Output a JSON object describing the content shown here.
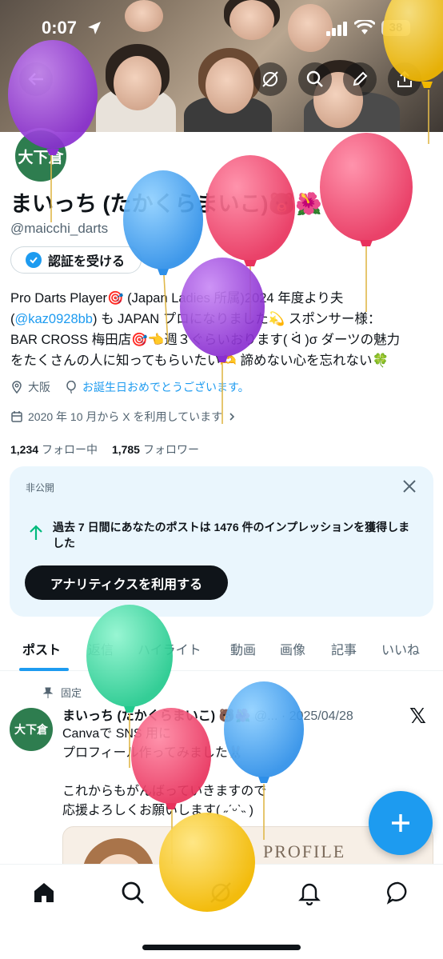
{
  "status_bar": {
    "time": "0:07",
    "battery": "38"
  },
  "profile": {
    "avatar_text": "大下倉",
    "name": "まいっち (たかくらまいこ)🐻🌺",
    "handle": "@maicchi_darts",
    "verify_button": "認証を受ける",
    "bio": {
      "line1": "Pro Darts Player🎯 (Japan Ladies 所属)2024 年度より夫",
      "mention": "@kaz0928bb",
      "line2_paren_open": "(",
      "line2_rest": ") も JAPAN プロになりました💫 スポンサー様：",
      "line3": "BAR CROSS 梅田店🎯👈週３ぐらいおります( ᐛ )σ ダーツの魅力",
      "line4": "をたくさんの人に知ってもらいたい🫶 諦めない心を忘れない🍀"
    },
    "location": "大阪",
    "birthday": "お誕生日おめでとうございます。",
    "joined": "2020 年 10 月から X を利用しています",
    "following_count": "1,234",
    "following_label": "フォロー中",
    "followers_count": "1,785",
    "followers_label": "フォロワー"
  },
  "analytics_card": {
    "private_label": "非公開",
    "message": "過去 7 日間にあなたのポストは 1476 件のインプレッションを獲得しました",
    "cta": "アナリティクスを利用する"
  },
  "tabs": [
    "ポスト",
    "返信",
    "ハイライト",
    "動画",
    "画像",
    "記事",
    "いいね"
  ],
  "post": {
    "pinned_label": "固定",
    "avatar_text": "大下倉",
    "author": "まいっち (たかくらまいこ) 🐻🌺",
    "handle_trunc": "@...",
    "date": "2025/04/28",
    "body": "Canvaで SNS 用に\nプロフィール作ってみました🐰\n\nこれからもがんばっていきますので\n応援よろしくお願いします( ˶ˊᵕˋ˵ )",
    "image_text": "PROFILE"
  },
  "colors": {
    "accent": "#1d9bf0",
    "text": "#0f1419",
    "muted": "#536471",
    "card_bg": "#eaf6fd",
    "avatar_green": "#2e7d4f"
  }
}
